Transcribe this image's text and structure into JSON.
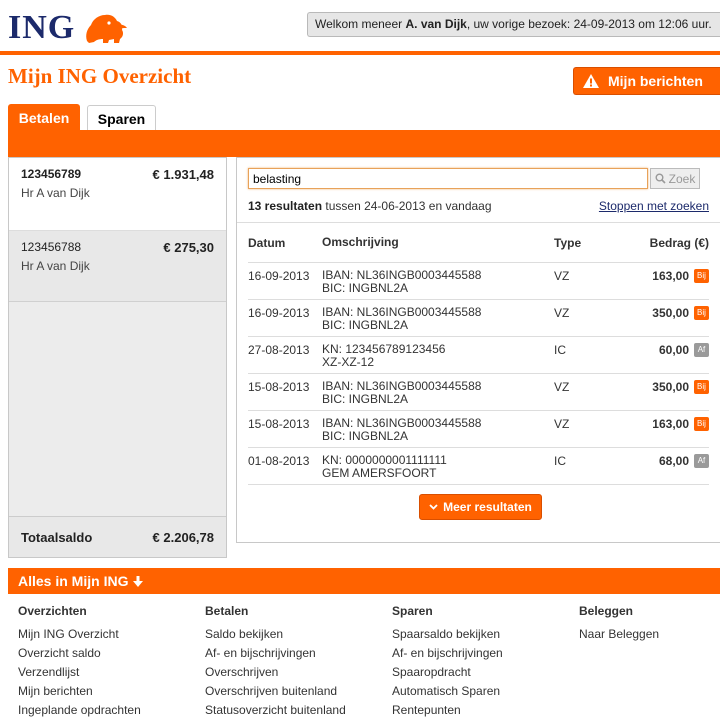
{
  "brand": {
    "logo_text": "ING",
    "accent": "#ff6200",
    "navy": "#1c2a6b"
  },
  "header": {
    "welcome_prefix": "Welkom meneer ",
    "welcome_name": "A. van Dijk",
    "welcome_suffix": ",  uw vorige bezoek: 24-09-2013 om 12:06 uur."
  },
  "page": {
    "title": "Mijn ING Overzicht",
    "messages_button": "Mijn berichten",
    "messages_icon": "warning-icon"
  },
  "tabs": [
    {
      "label": "Betalen",
      "active": true
    },
    {
      "label": "Sparen",
      "active": false
    }
  ],
  "accounts": [
    {
      "number": "123456789",
      "holder": "Hr A van Dijk",
      "balance": "€ 1.931,48",
      "selected": true
    },
    {
      "number": "123456788",
      "holder": "Hr A van Dijk",
      "balance": "€ 275,30",
      "selected": false
    }
  ],
  "total": {
    "label": "Totaalsaldo",
    "amount": "€ 2.206,78"
  },
  "search": {
    "value": "belasting",
    "button_label": "Zoek",
    "result_count": "13 resultaten",
    "result_range": " tussen 24-06-2013 en vandaag",
    "stop_link": "Stoppen met zoeken"
  },
  "table": {
    "headers": {
      "date": "Datum",
      "desc": "Omschrijving",
      "type": "Type",
      "amount": "Bedrag (€)"
    },
    "rows": [
      {
        "date": "16-09-2013",
        "desc1": "IBAN: NL36INGB0003445588",
        "desc2": "BIC: INGBNL2A",
        "type": "VZ",
        "amount": "163,00",
        "badge": "Bij"
      },
      {
        "date": "16-09-2013",
        "desc1": "IBAN: NL36INGB0003445588",
        "desc2": "BIC: INGBNL2A",
        "type": "VZ",
        "amount": "350,00",
        "badge": "Bij"
      },
      {
        "date": "27-08-2013",
        "desc1": "KN: 123456789123456",
        "desc2": "XZ-XZ-12",
        "type": "IC",
        "amount": "60,00",
        "badge": "Af"
      },
      {
        "date": "15-08-2013",
        "desc1": "IBAN: NL36INGB0003445588",
        "desc2": "BIC: INGBNL2A",
        "type": "VZ",
        "amount": "350,00",
        "badge": "Bij"
      },
      {
        "date": "15-08-2013",
        "desc1": "IBAN: NL36INGB0003445588",
        "desc2": "BIC: INGBNL2A",
        "type": "VZ",
        "amount": "163,00",
        "badge": "Bij"
      },
      {
        "date": "01-08-2013",
        "desc1": "KN: 0000000001111111",
        "desc2": "GEM AMERSFOORT",
        "type": "IC",
        "amount": "68,00",
        "badge": "Af"
      }
    ]
  },
  "more_button": "Meer resultaten",
  "alles": {
    "label": "Alles in Mijn ING"
  },
  "footer": {
    "overzichten": {
      "title": "Overzichten",
      "items": [
        "Mijn ING Overzicht",
        "Overzicht saldo",
        "Verzendlijst",
        "Mijn berichten",
        "Ingeplande opdrachten"
      ]
    },
    "betalen": {
      "title": "Betalen",
      "items": [
        "Saldo bekijken",
        "Af- en bijschrijvingen",
        "Overschrijven",
        "Overschrijven buitenland",
        "Statusoverzicht buitenland"
      ]
    },
    "sparen": {
      "title": "Sparen",
      "items": [
        "Spaarsaldo bekijken",
        "Af- en bijschrijvingen",
        "Spaaropdracht",
        "Automatisch Sparen",
        "Rentepunten"
      ]
    },
    "beleggen": {
      "title": "Beleggen",
      "items": [
        "Naar Beleggen"
      ]
    }
  }
}
